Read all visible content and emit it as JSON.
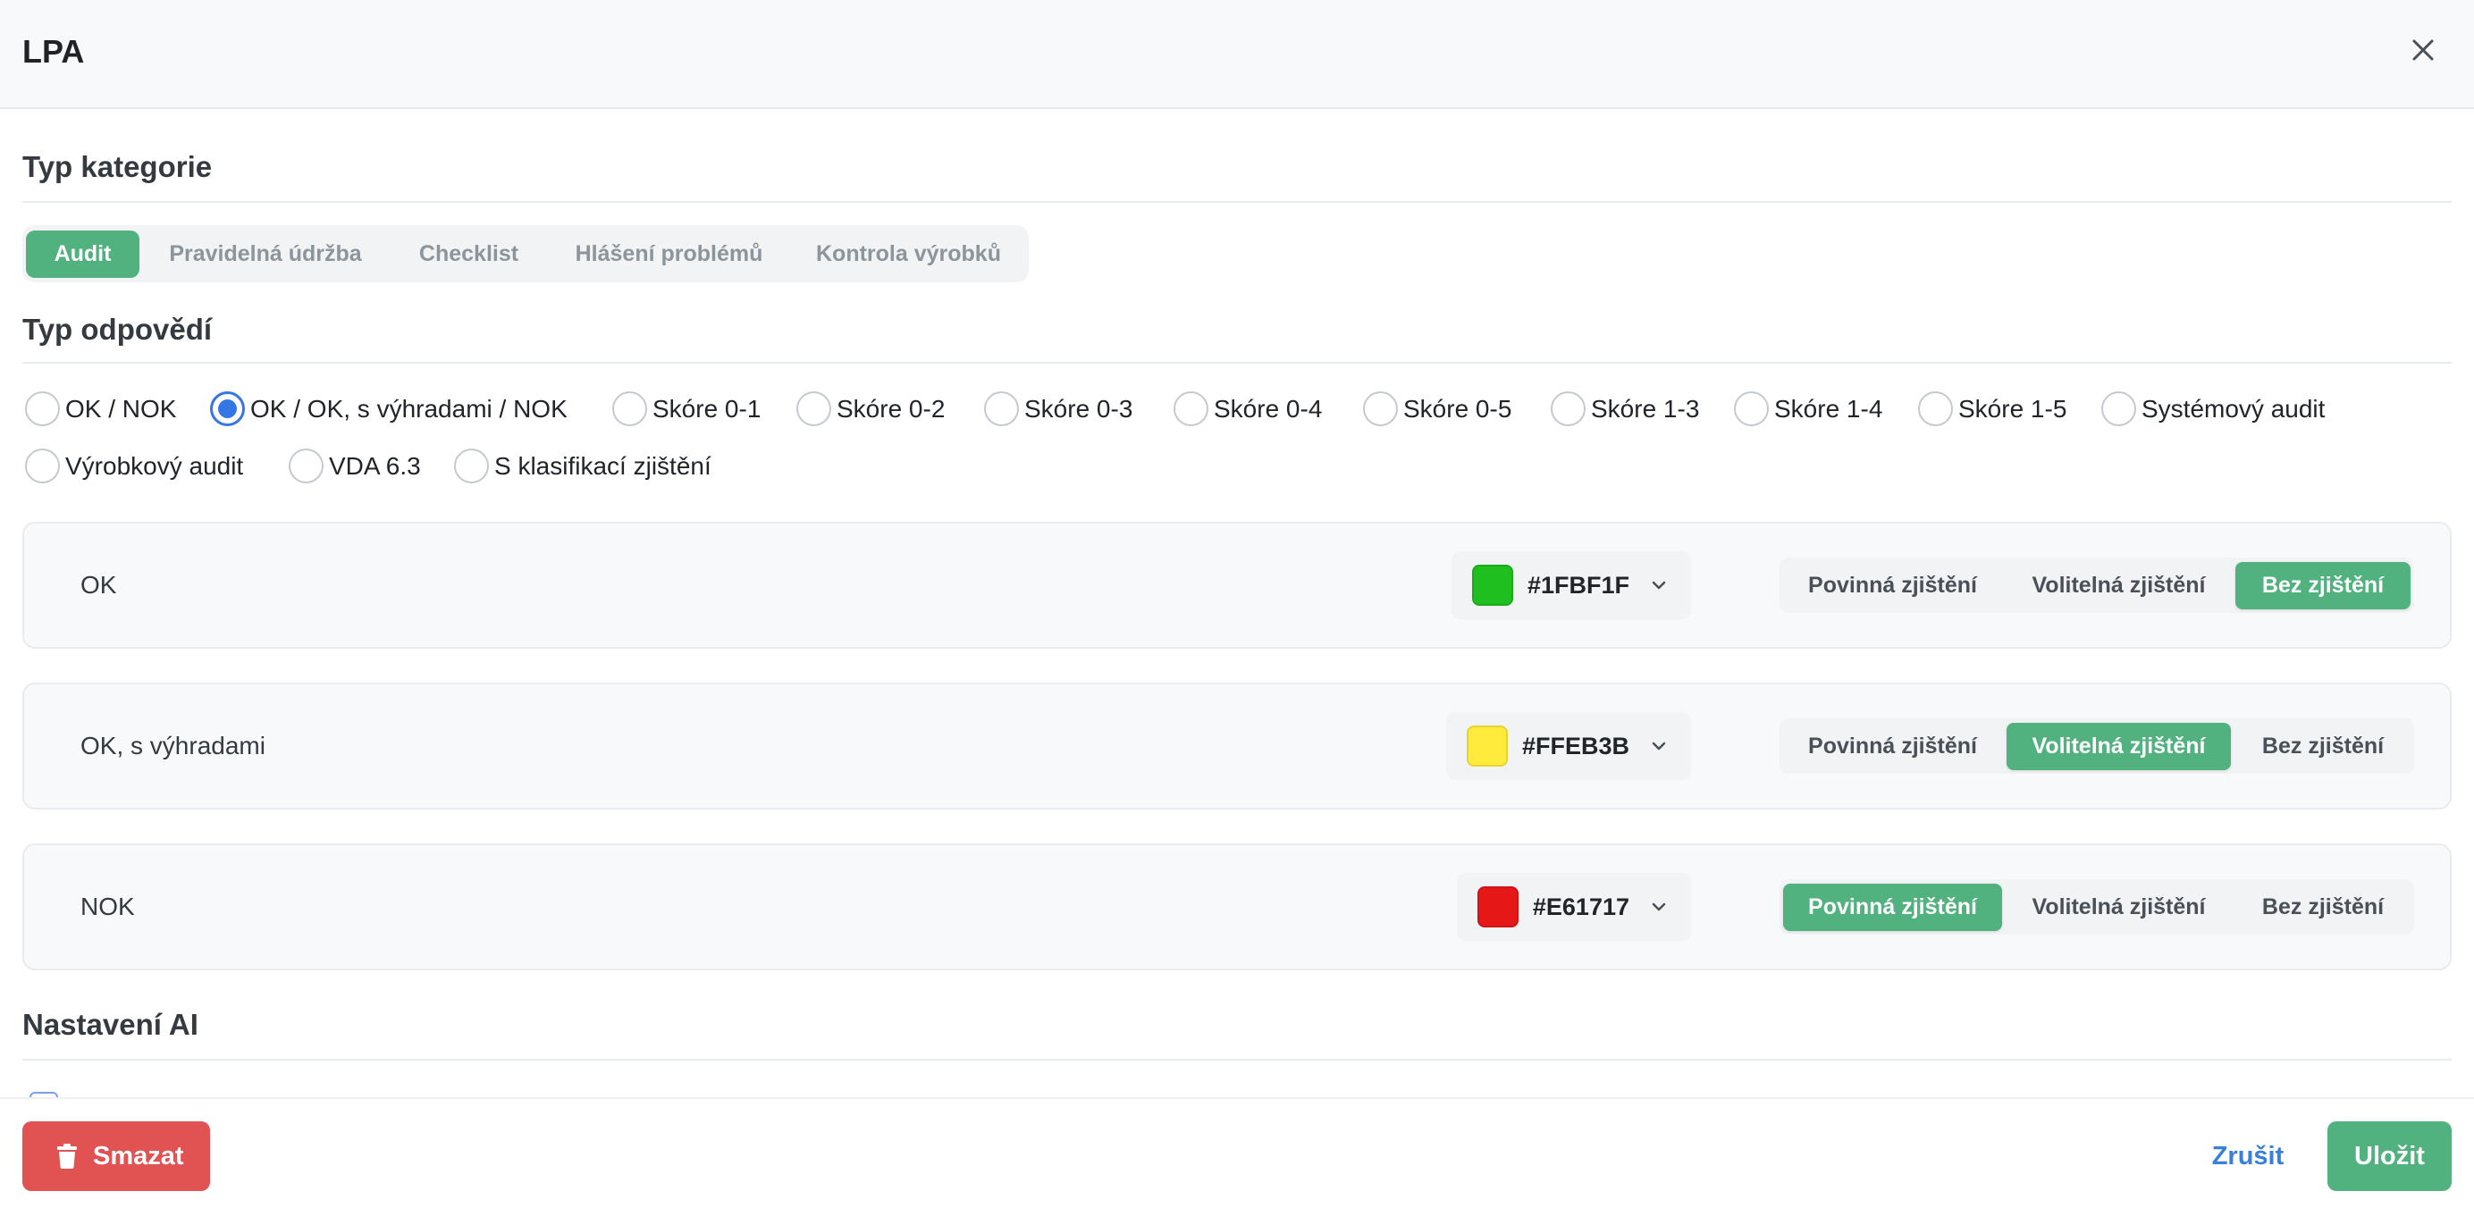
{
  "theme": {
    "accent": "#51b17f",
    "danger": "#e15353",
    "link": "#3a7fd8",
    "radio": "#3576e6"
  },
  "dialog": {
    "title": "LPA",
    "close_icon": "close-icon"
  },
  "category_type": {
    "heading": "Typ kategorie",
    "tabs": [
      {
        "label": "Audit",
        "active": true
      },
      {
        "label": "Pravidelná údržba",
        "active": false
      },
      {
        "label": "Checklist",
        "active": false
      },
      {
        "label": "Hlášení problémů",
        "active": false
      },
      {
        "label": "Kontrola výrobků",
        "active": false
      }
    ]
  },
  "response_type": {
    "heading": "Typ odpovědí",
    "options": [
      {
        "label": "OK / NOK",
        "selected": false
      },
      {
        "label": "OK / OK, s výhradami / NOK",
        "selected": true
      },
      {
        "label": "Skóre 0-1",
        "selected": false
      },
      {
        "label": "Skóre 0-2",
        "selected": false
      },
      {
        "label": "Skóre 0-3",
        "selected": false
      },
      {
        "label": "Skóre 0-4",
        "selected": false
      },
      {
        "label": "Skóre 0-5",
        "selected": false
      },
      {
        "label": "Skóre 1-3",
        "selected": false
      },
      {
        "label": "Skóre 1-4",
        "selected": false
      },
      {
        "label": "Skóre 1-5",
        "selected": false
      },
      {
        "label": "Systémový audit",
        "selected": false
      },
      {
        "label": "Výrobkový audit",
        "selected": false
      },
      {
        "label": "VDA 6.3",
        "selected": false
      },
      {
        "label": "S klasifikací zjištění",
        "selected": false
      }
    ]
  },
  "answers": [
    {
      "label": "OK",
      "color": "#1FBF1F",
      "findings": [
        {
          "label": "Povinná zjištění",
          "active": false
        },
        {
          "label": "Volitelná zjištění",
          "active": false
        },
        {
          "label": "Bez zjištění",
          "active": true
        }
      ]
    },
    {
      "label": "OK, s výhradami",
      "color": "#FFEB3B",
      "findings": [
        {
          "label": "Povinná zjištění",
          "active": false
        },
        {
          "label": "Volitelná zjištění",
          "active": true
        },
        {
          "label": "Bez zjištění",
          "active": false
        }
      ]
    },
    {
      "label": "NOK",
      "color": "#E61717",
      "findings": [
        {
          "label": "Povinná zjištění",
          "active": true
        },
        {
          "label": "Volitelná zjištění",
          "active": false
        },
        {
          "label": "Bez zjištění",
          "active": false
        }
      ]
    }
  ],
  "ai_settings": {
    "heading": "Nastavení AI"
  },
  "footer": {
    "delete_label": "Smazat",
    "delete_icon": "trash-icon",
    "cancel_label": "Zrušit",
    "save_label": "Uložit"
  }
}
